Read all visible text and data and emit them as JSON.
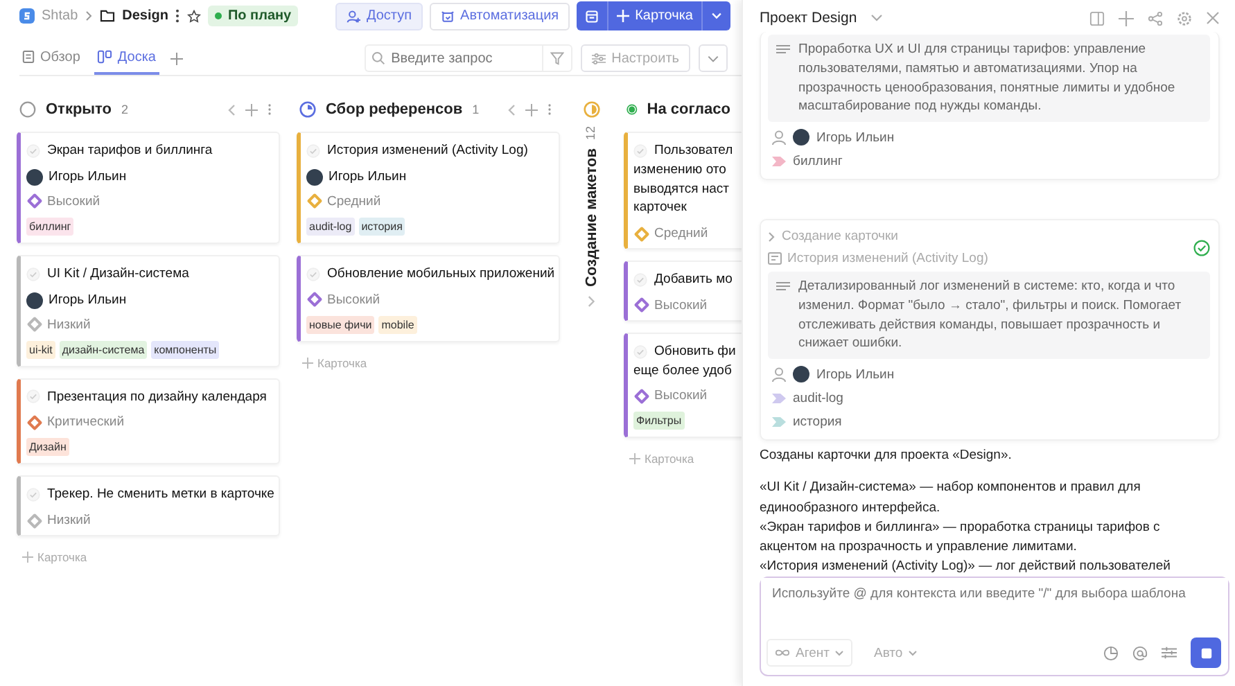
{
  "breadcrumb": {
    "app": "Shtab",
    "project": "Design",
    "status": "По плану"
  },
  "header_buttons": {
    "access": "Доступ",
    "automation": "Автоматизация",
    "add_card": "Карточка"
  },
  "tabs": [
    {
      "label": "Обзор",
      "kind": "overview",
      "selected": false
    },
    {
      "label": "Доска",
      "kind": "board",
      "selected": true
    }
  ],
  "search": {
    "placeholder": "Введите запрос"
  },
  "customize": "Настроить",
  "columns": [
    {
      "kind": "open",
      "collapsed": false,
      "name": "Открыто",
      "count": "2",
      "add_label": "Карточка",
      "cards": [
        {
          "title_lines": [
            "Экран тарифов и биллинга"
          ],
          "assignee": "Игорь Ильин",
          "priority": {
            "kind": "high",
            "label": "Высокий"
          },
          "tags": [
            {
              "label": "биллинг",
              "color": "#fbe4ec"
            }
          ]
        },
        {
          "title_lines": [
            "UI Kit / Дизайн-система"
          ],
          "assignee": "Игорь Ильин",
          "priority": {
            "kind": "low",
            "label": "Низкий"
          },
          "tags": [
            {
              "label": "ui-kit",
              "color": "#fdf0dc"
            },
            {
              "label": "дизайн-система",
              "color": "#e2f3e0"
            },
            {
              "label": "компоненты",
              "color": "#e4e6fb"
            }
          ]
        },
        {
          "title_lines": [
            "Презентация по дизайну календаря"
          ],
          "priority": {
            "kind": "critical",
            "label": "Критический"
          },
          "tags": [
            {
              "label": "Дизайн",
              "color": "#fde3da"
            }
          ]
        },
        {
          "title_lines": [
            "Трекер. Не сменить метки в карточке"
          ],
          "priority": {
            "kind": "low",
            "label": "Низкий"
          }
        }
      ]
    },
    {
      "kind": "progress",
      "collapsed": false,
      "name": "Сбор референсов",
      "count": "1",
      "add_label": "Карточка",
      "cards": [
        {
          "title_lines": [
            "История изменений (Activity Log)"
          ],
          "assignee": "Игорь Ильин",
          "priority": {
            "kind": "medium",
            "label": "Средний"
          },
          "tags": [
            {
              "label": "audit-log",
              "color": "#ecebf7"
            },
            {
              "label": "история",
              "color": "#e0eef3"
            }
          ]
        },
        {
          "title_lines": [
            "Обновление мобильных приложений"
          ],
          "priority": {
            "kind": "high",
            "label": "Высокий"
          },
          "tags": [
            {
              "label": "новые фичи",
              "color": "#fbe3dc"
            },
            {
              "label": "mobile",
              "color": "#fdf0dc"
            }
          ]
        }
      ]
    },
    {
      "kind": "half",
      "collapsed": true,
      "name": "Создание макетов",
      "count": "12"
    },
    {
      "kind": "done",
      "collapsed": false,
      "name": "На согласо",
      "add_label": "Карточка",
      "cards": [
        {
          "title_lines": [
            "Пользовател",
            "изменению ото",
            "выводятся наст",
            "карточек"
          ],
          "priority": {
            "kind": "medium",
            "label": "Средний"
          }
        },
        {
          "title_lines": [
            "Добавить мо"
          ],
          "priority": {
            "kind": "high",
            "label": "Высокий"
          }
        },
        {
          "title_lines": [
            "Обновить фи",
            "еще более удоб"
          ],
          "priority": {
            "kind": "high",
            "label": "Высокий"
          },
          "tags": [
            {
              "label": "Фильтры",
              "color": "#dff2dc"
            }
          ]
        }
      ]
    }
  ],
  "panel": {
    "title": "Проект Design",
    "cards": [
      {
        "description": "Проработка UX и UI для страницы тарифов: управление пользователями, памятью и автоматизациями. Упор на прозрачность ценообразования, понятные лимиты и удобное масштабирование под нужды команды.",
        "assignee": "Игорь Ильин",
        "tags": [
          {
            "label": "биллинг",
            "color": "#f3b6c6"
          }
        ]
      },
      {
        "step": "Создание карточки",
        "done": true,
        "card_title": "История изменений (Activity Log)",
        "description": "Детализированный лог изменений в системе: кто, когда и что изменил. Формат \"было → стало\", фильтры и поиск. Помогает отслеживать действия команды, повышает прозрачность и снижает ошибки.",
        "assignee": "Игорь Ильин",
        "tags": [
          {
            "label": "audit-log",
            "color": "#cfc9ef"
          },
          {
            "label": "история",
            "color": "#b9dede"
          }
        ]
      }
    ],
    "reply": {
      "intro": "Созданы карточки для проекта «Design».",
      "lines": [
        "«UI Kit / Дизайн-система» — набор компонентов и правил для единообразного интерфейса.",
        "«Экран тарифов и биллинга» — проработка страницы тарифов с акцентом на прозрачность и управление лимитами.",
        "«История изменений (Activity Log)» — лог действий пользователей"
      ]
    },
    "composer": {
      "placeholder": "Используйте @ для контекста или введите \"/\" для выбора шаблона",
      "agent": "Агент",
      "model": "Авто"
    }
  }
}
